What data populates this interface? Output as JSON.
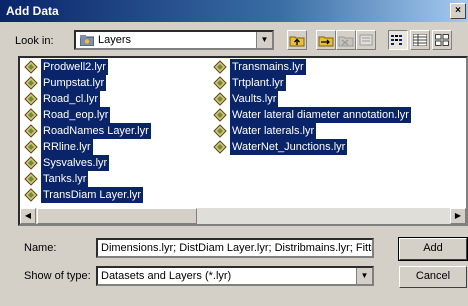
{
  "dialog": {
    "title": "Add Data",
    "close_glyph": "×"
  },
  "look_in": {
    "label": "Look in:",
    "value": "Layers"
  },
  "toolbar": {
    "up_icon": "up-folder-icon",
    "connect_icon": "connect-folder-icon",
    "disconnect_icon": "disconnect-folder-icon",
    "properties_icon": "properties-icon",
    "list_view_icon": "list-view-icon",
    "details_view_icon": "details-view-icon",
    "thumbnail_view_icon": "thumbnail-view-icon"
  },
  "files": {
    "column1": [
      "Prodwell2.lyr",
      "Pumpstat.lyr",
      "Road_cl.lyr",
      "Road_eop.lyr",
      "RoadNames Layer.lyr",
      "RRline.lyr",
      "Sysvalves.lyr",
      "Tanks.lyr",
      "TransDiam Layer.lyr"
    ],
    "column2": [
      "Transmains.lyr",
      "Trtplant.lyr",
      "Vaults.lyr",
      "Water lateral diameter annotation.lyr",
      "Water laterals.lyr",
      "WaterNet_Junctions.lyr"
    ]
  },
  "name_field": {
    "label": "Name:",
    "value": "Dimensions.lyr; DistDiam Layer.lyr; Distribmains.lyr; Fittings.ly"
  },
  "type_field": {
    "label": "Show of type:",
    "value": "Datasets and Layers (*.lyr)"
  },
  "buttons": {
    "add": "Add",
    "cancel": "Cancel"
  },
  "colors": {
    "selection": "#0a246a",
    "dialog_bg": "#d4d0c8",
    "title_start": "#0a246a"
  }
}
